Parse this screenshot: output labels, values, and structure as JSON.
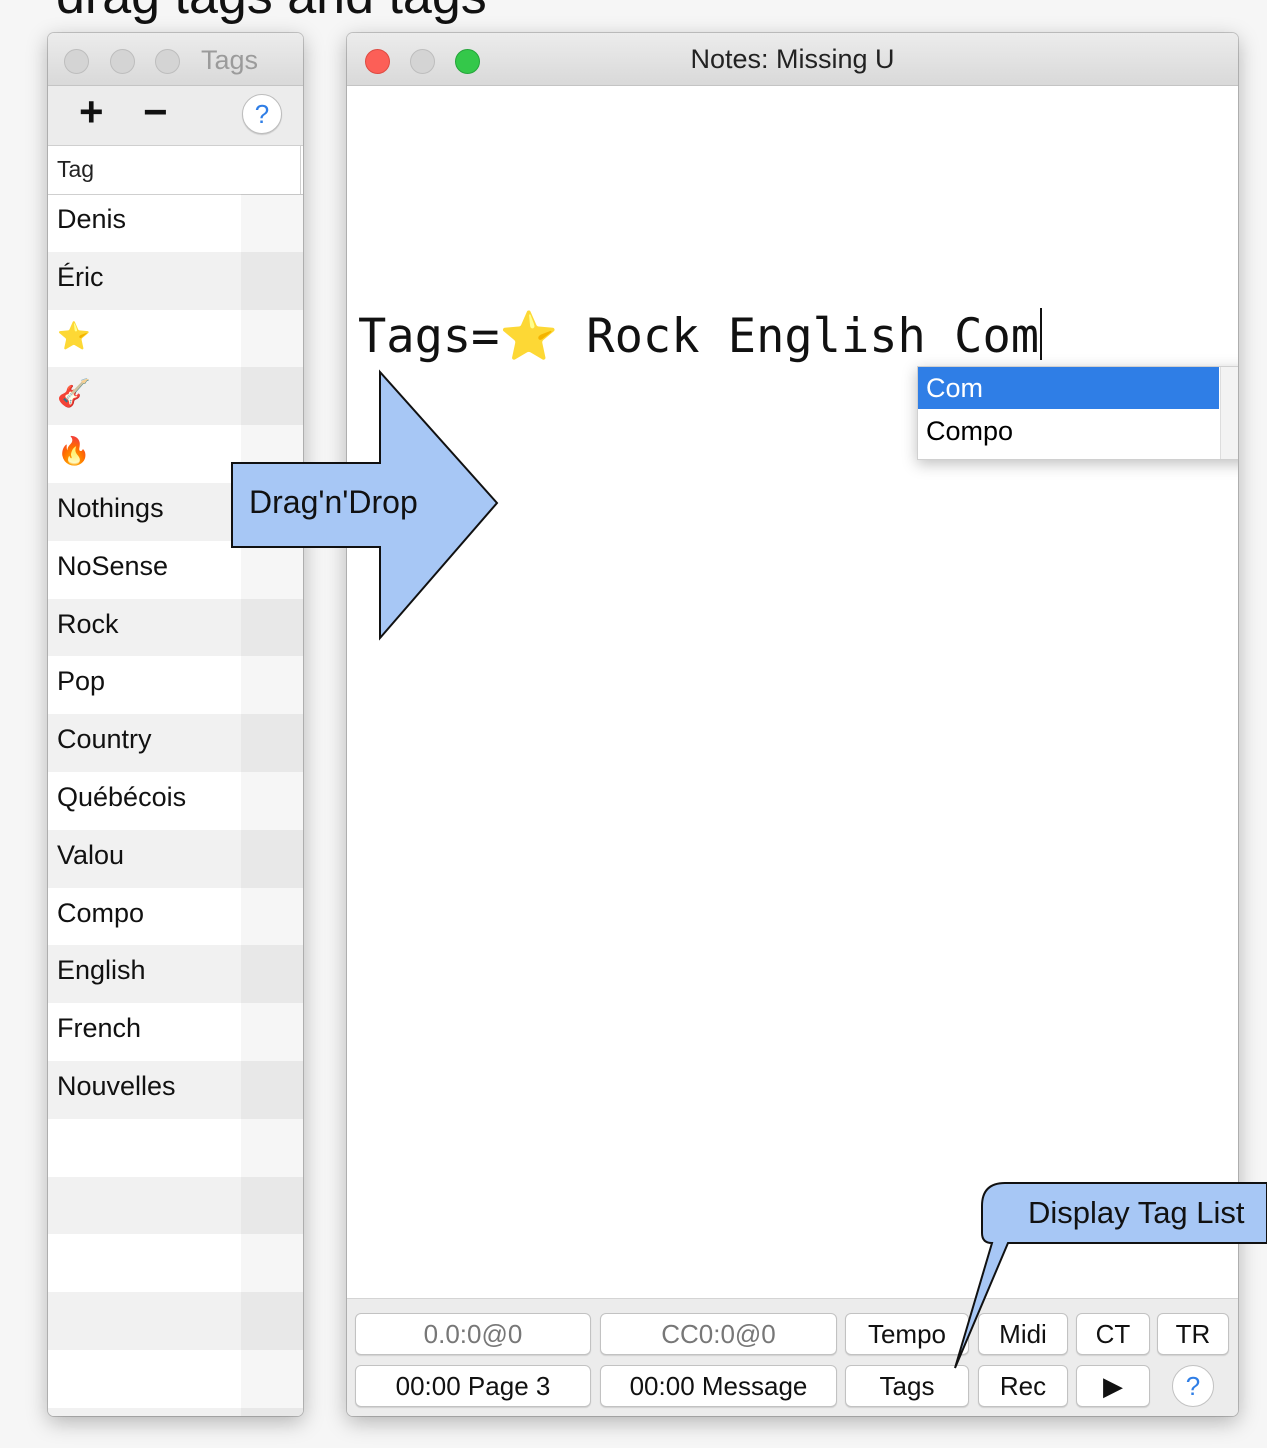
{
  "tags_window": {
    "title": "Tags",
    "add_label": "+",
    "remove_label": "−",
    "help_label": "?",
    "column_header": "Tag",
    "items": [
      "Denis",
      "Éric",
      "⭐",
      "🎸",
      "🔥",
      "Nothings",
      "NoSense",
      "Rock",
      "Pop",
      "Country",
      "Québécois",
      "Valou",
      "Compo",
      "English",
      "French",
      "Nouvelles",
      "",
      "",
      "",
      "",
      "",
      ""
    ]
  },
  "notes_window": {
    "title": "Notes: Missing U",
    "editor_text": "Tags=⭐ Rock English Com",
    "autocomplete": [
      "Com",
      "Compo"
    ],
    "bottom": {
      "position": "0.0:0@0",
      "cc": "CC0:0@0",
      "tempo": "Tempo",
      "midi": "Midi",
      "ct": "CT",
      "tr": "TR",
      "time_page": "00:00 Page 3",
      "time_message": "00:00 Message",
      "tags": "Tags",
      "rec": "Rec",
      "play": "▶",
      "help": "?"
    }
  },
  "annotations": {
    "arrow_text": "Drag'n'Drop",
    "callout_text": "Display Tag List"
  },
  "colors": {
    "selection": "#2f7ee6",
    "annotation_fill": "#a7c7f5"
  }
}
